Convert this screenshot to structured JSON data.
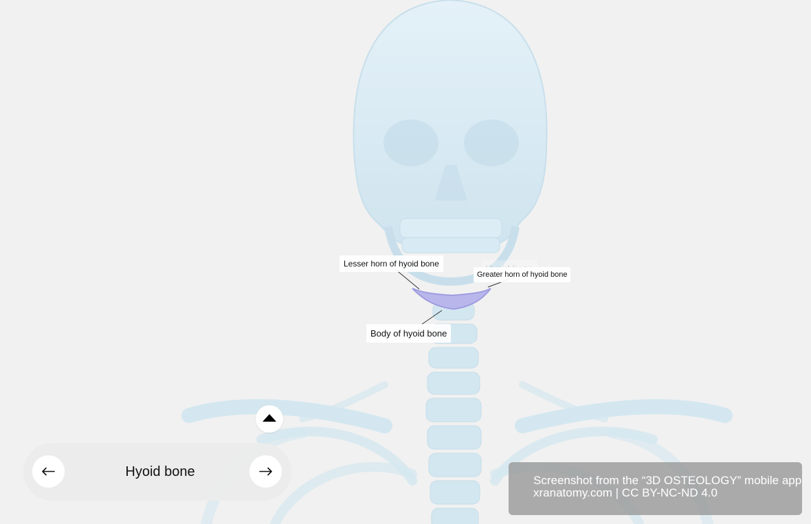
{
  "labels": {
    "lesser_horn": "Lesser horn of hyoid bone",
    "greater_horn": "Greater horn of hyoid bone",
    "body": "Body of hyoid bone",
    "ghost": "Hyoid bone"
  },
  "navigation": {
    "title": "Hyoid bone",
    "prev_icon": "arrow-left-icon",
    "next_icon": "arrow-right-icon",
    "collapse_icon": "triangle-up-icon"
  },
  "credit": {
    "line1": "Screenshot from the “3D OSTEOLOGY” mobile app",
    "line2": "xranatomy.com | CC BY-NC-ND 4.0"
  },
  "colors": {
    "background": "#f1f1f1",
    "bone": "#d6e9f3",
    "highlight": "#b9b6ec"
  }
}
